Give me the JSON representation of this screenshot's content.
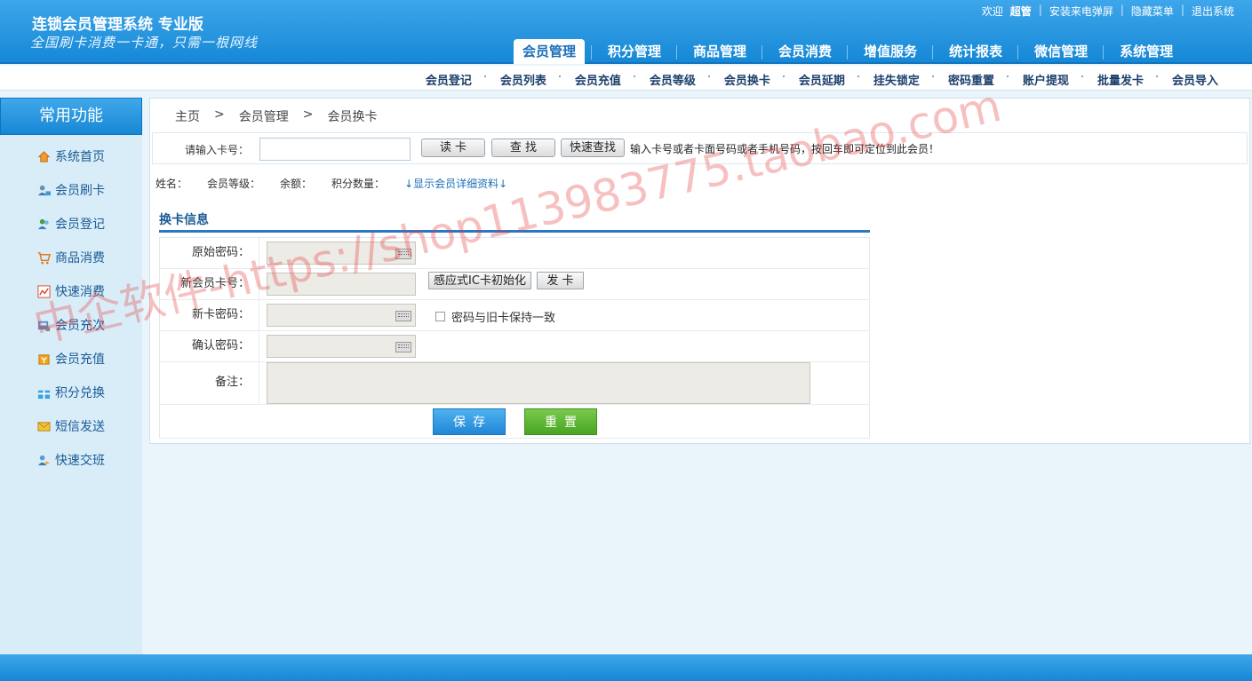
{
  "header": {
    "app_title": "连锁会员管理系统 专业版",
    "slogan": "全国刷卡消费一卡通，只需一根网线",
    "welcome": "欢迎",
    "user": "超管",
    "links": [
      "安装来电弹屏",
      "隐藏菜单",
      "退出系统"
    ]
  },
  "main_nav": [
    "会员管理",
    "积分管理",
    "商品管理",
    "会员消费",
    "增值服务",
    "统计报表",
    "微信管理",
    "系统管理"
  ],
  "main_nav_active": "会员管理",
  "sub_nav": [
    "会员登记",
    "会员列表",
    "会员充值",
    "会员等级",
    "会员换卡",
    "会员延期",
    "挂失锁定",
    "密码重置",
    "账户提现",
    "批量发卡",
    "会员导入"
  ],
  "sidebar": {
    "title": "常用功能",
    "items": [
      {
        "label": "系统首页",
        "icon": "home-icon"
      },
      {
        "label": "会员刷卡",
        "icon": "user-card-icon"
      },
      {
        "label": "会员登记",
        "icon": "user-add-icon"
      },
      {
        "label": "商品消费",
        "icon": "cart-icon"
      },
      {
        "label": "快速消费",
        "icon": "chart-icon"
      },
      {
        "label": "会员充次",
        "icon": "counter-icon"
      },
      {
        "label": "会员充值",
        "icon": "coin-icon"
      },
      {
        "label": "积分兑换",
        "icon": "gift-icon"
      },
      {
        "label": "短信发送",
        "icon": "mail-icon"
      },
      {
        "label": "快速交班",
        "icon": "handover-icon"
      }
    ]
  },
  "breadcrumb": [
    "主页",
    "会员管理",
    "会员换卡"
  ],
  "breadcrumb_sep": ">",
  "search": {
    "label": "请输入卡号：",
    "value": "",
    "read_btn": "读 卡",
    "find_btn": "查 找",
    "quick_btn": "快速查找",
    "hint": "输入卡号或者卡面号码或者手机号码，按回车即可定位到此会员！"
  },
  "member_info": {
    "name": "姓名：",
    "level": "会员等级：",
    "balance": "余额：",
    "points": "积分数量：",
    "detail_link": "↓显示会员详细资料↓"
  },
  "form": {
    "section_title": "换卡信息",
    "orig_pwd_label": "原始密码：",
    "new_card_label": "新会员卡号：",
    "ic_init_btn": "感应式IC卡初始化",
    "issue_btn": "发 卡",
    "new_pwd_label": "新卡密码：",
    "same_pwd_checkbox": "密码与旧卡保持一致",
    "confirm_pwd_label": "确认密码：",
    "remark_label": "备注：",
    "save_btn": "保存",
    "reset_btn": "重置"
  },
  "watermark": "中企软件-https://shop113983775.taobao.com",
  "colors": {
    "header_blue": "#1a8ad8",
    "sidebar_bg": "#d9edf9",
    "save_blue": "#2a93e0",
    "reset_green": "#5cb836",
    "link_blue": "#1a6fb7"
  }
}
